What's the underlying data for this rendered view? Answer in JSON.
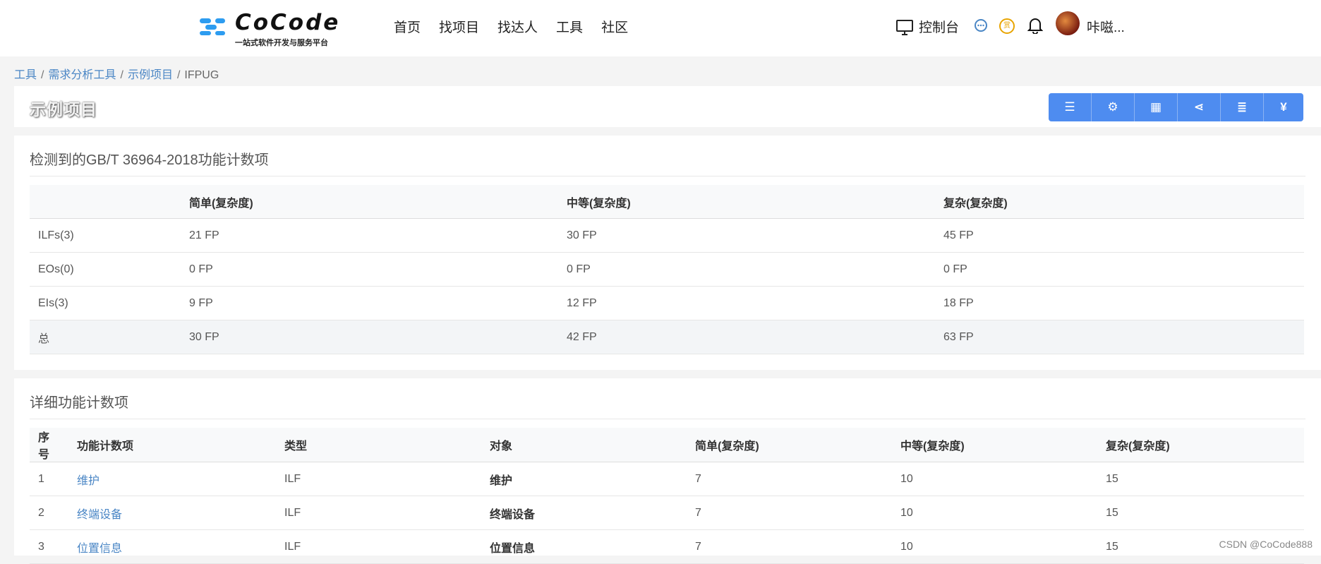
{
  "header": {
    "brand": "CoCode",
    "slogan": "一站式软件开发与服务平台",
    "nav": [
      "首页",
      "找项目",
      "找达人",
      "工具",
      "社区"
    ],
    "console_label": "控制台",
    "username": "咔嗞...",
    "badge_char": "赏"
  },
  "breadcrumb": {
    "items": [
      "工具",
      "需求分析工具",
      "示例项目"
    ],
    "current": "IFPUG"
  },
  "project": {
    "title": "示例项目",
    "toolbar": [
      {
        "icon": "list-icon",
        "glyph": "☰"
      },
      {
        "icon": "gear-icon",
        "glyph": "⚙"
      },
      {
        "icon": "grid-icon",
        "glyph": "▦"
      },
      {
        "icon": "share-icon",
        "glyph": "⋖"
      },
      {
        "icon": "ordered-list-icon",
        "glyph": "≣"
      },
      {
        "icon": "yen-icon",
        "glyph": "¥"
      }
    ]
  },
  "summary": {
    "title": "检测到的GB/T 36964-2018功能计数项",
    "headers": [
      "",
      "简单(复杂度)",
      "中等(复杂度)",
      "复杂(复杂度)"
    ],
    "rows": [
      [
        "ILFs(3)",
        "21 FP",
        "30 FP",
        "45 FP"
      ],
      [
        "EOs(0)",
        "0 FP",
        "0 FP",
        "0 FP"
      ],
      [
        "EIs(3)",
        "9 FP",
        "12 FP",
        "18 FP"
      ],
      [
        "总",
        "30 FP",
        "42 FP",
        "63 FP"
      ]
    ]
  },
  "detail": {
    "title": "详细功能计数项",
    "headers": [
      "序号",
      "功能计数项",
      "类型",
      "对象",
      "简单(复杂度)",
      "中等(复杂度)",
      "复杂(复杂度)"
    ],
    "rows": [
      [
        "1",
        "维护",
        "ILF",
        "维护",
        "7",
        "10",
        "15"
      ],
      [
        "2",
        "终端设备",
        "ILF",
        "终端设备",
        "7",
        "10",
        "15"
      ],
      [
        "3",
        "位置信息",
        "ILF",
        "位置信息",
        "7",
        "10",
        "15"
      ]
    ]
  },
  "watermark": "CSDN @CoCode888",
  "colors": {
    "accent": "#4e8cf0",
    "link": "#4a86c5",
    "logo_blue": "#2d9cf0"
  }
}
